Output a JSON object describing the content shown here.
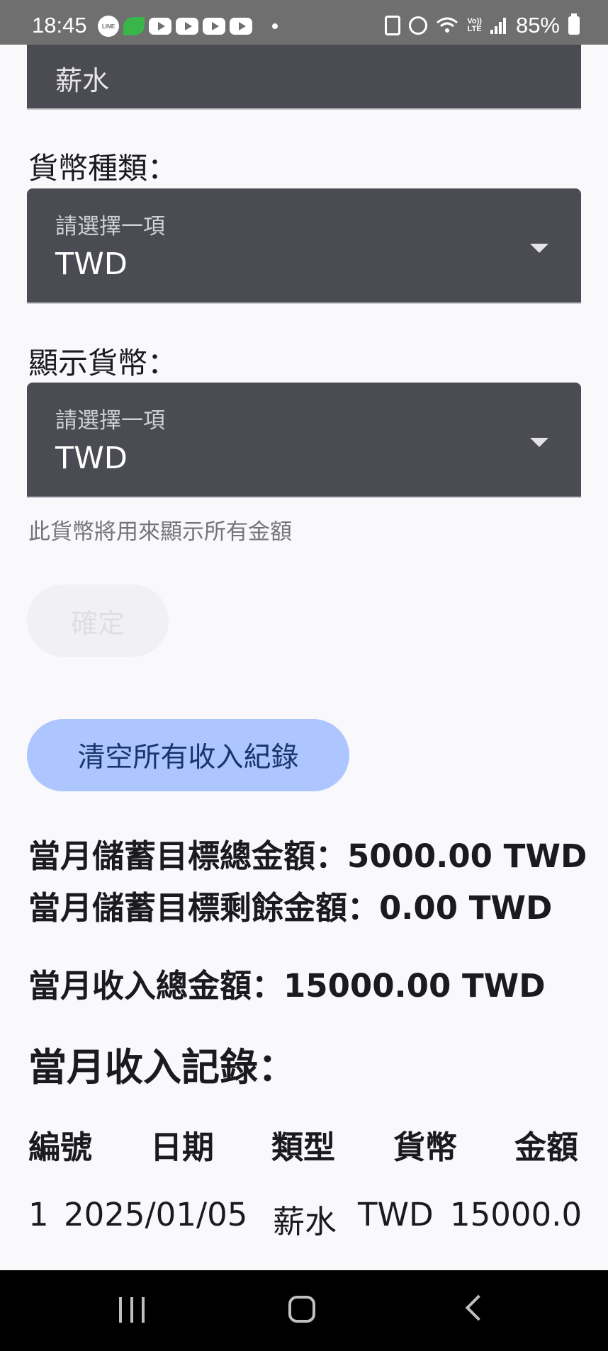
{
  "status_bar": {
    "time": "18:45",
    "battery": "85%",
    "notification_icons": [
      "line-icon",
      "leaf-icon",
      "youtube-icon",
      "youtube-icon",
      "youtube-icon",
      "youtube-icon"
    ],
    "volte_line1": "Vo))",
    "volte_line2": "LTE"
  },
  "form": {
    "type_value": "薪水",
    "currency_label": "貨幣種類：",
    "currency_select": {
      "label": "請選擇一項",
      "value": "TWD"
    },
    "display_label": "顯示貨幣：",
    "display_select": {
      "label": "請選擇一項",
      "value": "TWD"
    },
    "display_helper": "此貨幣將用來顯示所有金額",
    "confirm_label": "確定",
    "clear_label": "清空所有收入紀錄"
  },
  "summary": {
    "goal_total": "當月儲蓄目標總金額：5000.00 TWD",
    "goal_remaining": "當月儲蓄目標剩餘金額：0.00 TWD",
    "income_total": "當月收入總金額：15000.00 TWD"
  },
  "records": {
    "title": "當月收入記錄：",
    "columns": [
      "編號",
      "日期",
      "類型",
      "貨幣",
      "金額"
    ],
    "rows": [
      {
        "id": "1",
        "date": "2025/01/05",
        "type": "薪水",
        "currency": "TWD",
        "amount": "15000.0"
      }
    ]
  },
  "colors": {
    "accent": "#adc6ff",
    "field_bg": "#4a4b53",
    "page_bg": "#f9f9fb"
  }
}
